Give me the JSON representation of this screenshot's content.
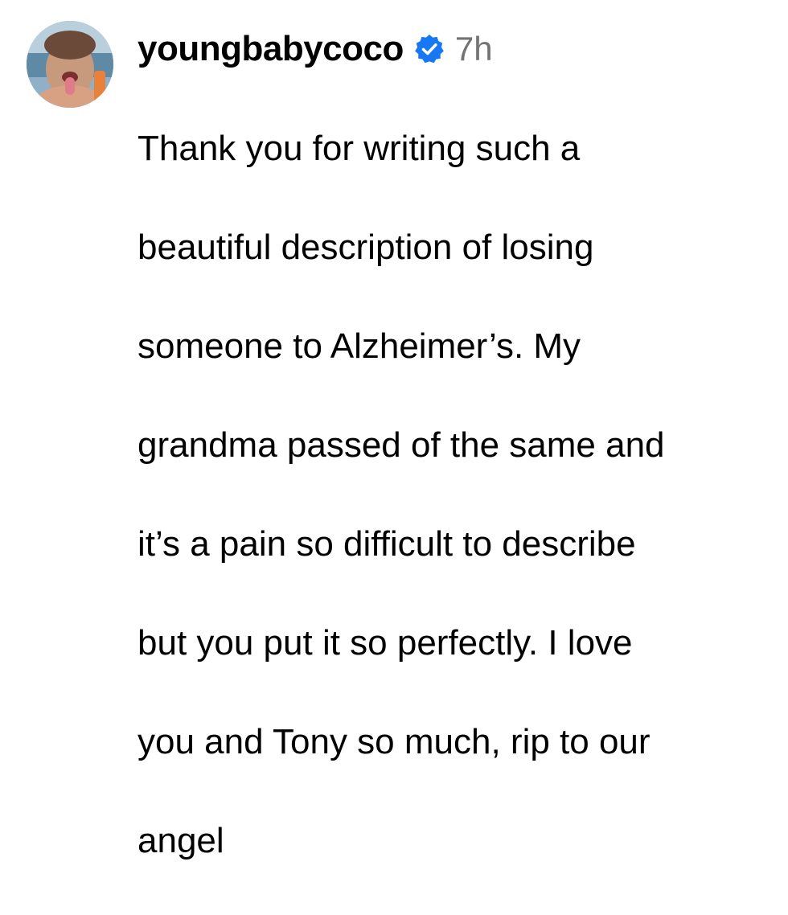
{
  "comment": {
    "avatar_icon": "profile-photo",
    "username": "youngbabycoco",
    "verified_icon": "verified-badge-icon",
    "verified_color": "#1877F2",
    "timestamp": "7h",
    "text_lines": [
      "Thank you for writing such a",
      "beautiful description of losing",
      "someone to Alzheimer’s. My",
      "grandma passed of the same and",
      "it’s a pain so difficult to describe",
      "but you put it so perfectly. I love",
      "you and Tony so much, rip to our",
      "angel"
    ]
  }
}
